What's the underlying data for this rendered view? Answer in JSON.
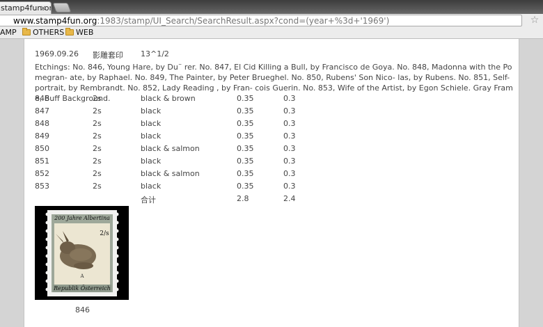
{
  "browser": {
    "tab_title": "stamp4fun.org",
    "tab_close_glyph": "×",
    "url_host": "www.stamp4fun.org",
    "url_rest": ":1983/stamp/UI_Search/SearchResult.aspx?cond=(year+%3d+'1969')",
    "bookmarks": [
      {
        "label": "AMP",
        "has_folder": false
      },
      {
        "label": "OTHERS",
        "has_folder": true
      },
      {
        "label": "WEB",
        "has_folder": true
      }
    ]
  },
  "issue": {
    "date": "1969.09.26",
    "type": "影雕套印",
    "perforation": "13^1/2",
    "description": "Etchings: No. 846, Young Hare, by Du¨ rer. No. 847, El Cid Killing a Bull, by Francisco de Goya. No. 848, Madonna with the Pomegran- ate, by Raphael. No. 849, The Painter, by Peter Brueghel. No. 850, Rubens' Son Nico- las, by Rubens. No. 851, Self-portrait, by Rembrandt. No. 852, Lady Reading , by Fran- cois Guerin. No. 853, Wife of the Artist, by Egon Schiele. Gray Frame, Buff Background."
  },
  "stamps": [
    {
      "no": "846",
      "value": "2s",
      "color": "black & brown",
      "mint": "0.35",
      "used": "0.3"
    },
    {
      "no": "847",
      "value": "2s",
      "color": "black",
      "mint": "0.35",
      "used": "0.3"
    },
    {
      "no": "848",
      "value": "2s",
      "color": "black",
      "mint": "0.35",
      "used": "0.3"
    },
    {
      "no": "849",
      "value": "2s",
      "color": "black",
      "mint": "0.35",
      "used": "0.3"
    },
    {
      "no": "850",
      "value": "2s",
      "color": "black & salmon",
      "mint": "0.35",
      "used": "0.3"
    },
    {
      "no": "851",
      "value": "2s",
      "color": "black",
      "mint": "0.35",
      "used": "0.3"
    },
    {
      "no": "852",
      "value": "2s",
      "color": "black & salmon",
      "mint": "0.35",
      "used": "0.3"
    },
    {
      "no": "853",
      "value": "2s",
      "color": "black",
      "mint": "0.35",
      "used": "0.3"
    }
  ],
  "total": {
    "label": "合计",
    "mint": "2.8",
    "used": "2.4"
  },
  "stamp_image": {
    "top_text": "200 Jahre Albertina",
    "value_text": "2/s",
    "bottom_text": "Republik Österreich",
    "caption": "846"
  }
}
